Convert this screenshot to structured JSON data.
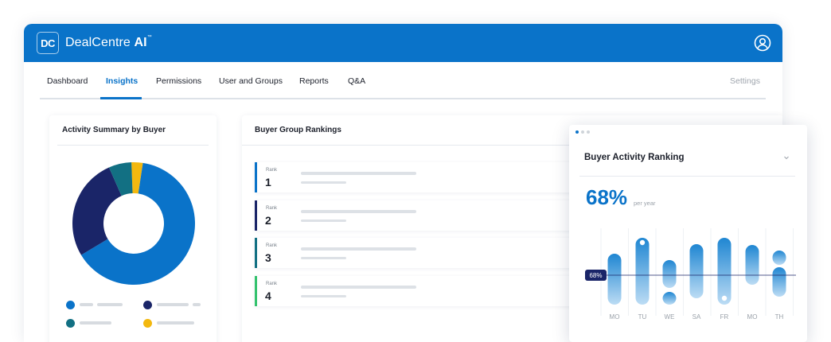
{
  "app": {
    "logo_text": "DC",
    "brand_name": "DealCentre",
    "brand_suffix": "AI",
    "brand_tm": "™",
    "accent_color": "#0a73c9"
  },
  "nav": {
    "tabs": [
      {
        "label": "Dashboard",
        "active": false
      },
      {
        "label": "Insights",
        "active": true
      },
      {
        "label": "Permissions",
        "active": false
      },
      {
        "label": "User and Groups",
        "active": false
      },
      {
        "label": "Reports",
        "active": false
      },
      {
        "label": "Q&A",
        "active": false
      }
    ],
    "settings_label": "Settings"
  },
  "activity_summary": {
    "title": "Activity Summary by Buyer",
    "legend_colors": [
      "#0a73c9",
      "#1a2568",
      "#127083",
      "#f3b80f"
    ]
  },
  "rankings": {
    "title": "Buyer Group Rankings",
    "rank_label": "Rank",
    "rows": [
      {
        "rank": "1",
        "accent": "#0a73c9"
      },
      {
        "rank": "2",
        "accent": "#1a2568"
      },
      {
        "rank": "3",
        "accent": "#127083"
      },
      {
        "rank": "4",
        "accent": "#34c26e"
      }
    ]
  },
  "activity_ranking": {
    "title": "Buyer Activity Ranking",
    "percent": "68%",
    "percent_suffix": "per year",
    "marker_label": "68%"
  },
  "chart_data": [
    {
      "type": "pie",
      "title": "Activity Summary by Buyer",
      "values": [
        64,
        27,
        6,
        3
      ],
      "colors": [
        "#0a73c9",
        "#1a2568",
        "#127083",
        "#f3b80f"
      ]
    },
    {
      "type": "bar",
      "title": "Buyer Activity Ranking",
      "categories": [
        "MO",
        "TU",
        "WE",
        "SA",
        "FR",
        "MO",
        "TH"
      ],
      "reference_line": 68,
      "reference_label": "68%"
    }
  ]
}
